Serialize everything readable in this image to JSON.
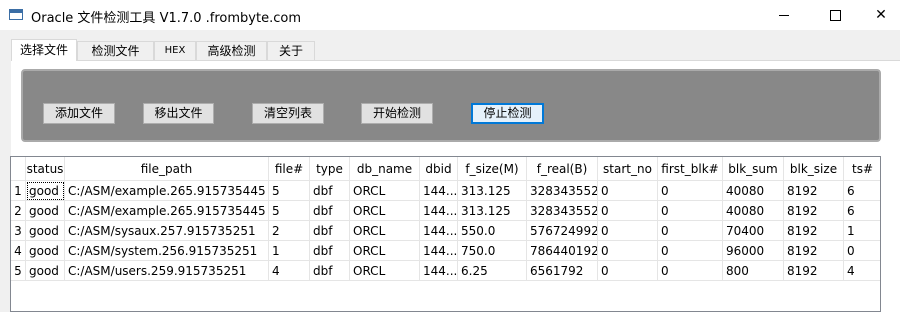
{
  "window": {
    "title": "Oracle 文件检测工具  V1.7.0 .frombyte.com",
    "minimize": "—",
    "maximize": "☐",
    "close": "✕"
  },
  "tabs": [
    {
      "label": "选择文件",
      "active": true
    },
    {
      "label": "检测文件",
      "active": false
    },
    {
      "label": "HEX",
      "active": false
    },
    {
      "label": "高级检测",
      "active": false
    },
    {
      "label": "关于",
      "active": false
    }
  ],
  "toolbar": {
    "add_label": "添加文件",
    "remove_label": "移出文件",
    "clear_label": "清空列表",
    "start_label": "开始检测",
    "stop_label": "停止检测"
  },
  "table": {
    "columns": [
      "status",
      "file_path",
      "file#",
      "type",
      "db_name",
      "dbid",
      "f_size(M)",
      "f_real(B)",
      "start_no",
      "first_blk#",
      "blk_sum",
      "blk_size",
      "ts#"
    ],
    "rows": [
      {
        "num": "1",
        "cells": [
          "good",
          "C:/ASM/example.265.915735445",
          "5",
          "dbf",
          "ORCL",
          "144...",
          "313.125",
          "328343552",
          "0",
          "0",
          "40080",
          "8192",
          "6"
        ]
      },
      {
        "num": "2",
        "cells": [
          "good",
          "C:/ASM/example.265.915735445",
          "5",
          "dbf",
          "ORCL",
          "144...",
          "313.125",
          "328343552",
          "0",
          "0",
          "40080",
          "8192",
          "6"
        ]
      },
      {
        "num": "3",
        "cells": [
          "good",
          "C:/ASM/sysaux.257.915735251",
          "2",
          "dbf",
          "ORCL",
          "144...",
          "550.0",
          "576724992",
          "0",
          "0",
          "70400",
          "8192",
          "1"
        ]
      },
      {
        "num": "4",
        "cells": [
          "good",
          "C:/ASM/system.256.915735251",
          "1",
          "dbf",
          "ORCL",
          "144...",
          "750.0",
          "786440192",
          "0",
          "0",
          "96000",
          "8192",
          "0"
        ]
      },
      {
        "num": "5",
        "cells": [
          "good",
          "C:/ASM/users.259.915735251",
          "4",
          "dbf",
          "ORCL",
          "144...",
          "6.25",
          "6561792",
          "0",
          "0",
          "800",
          "8192",
          "4"
        ]
      }
    ]
  },
  "colors": {
    "panel": "#888888",
    "focus_border": "#0078d7"
  }
}
